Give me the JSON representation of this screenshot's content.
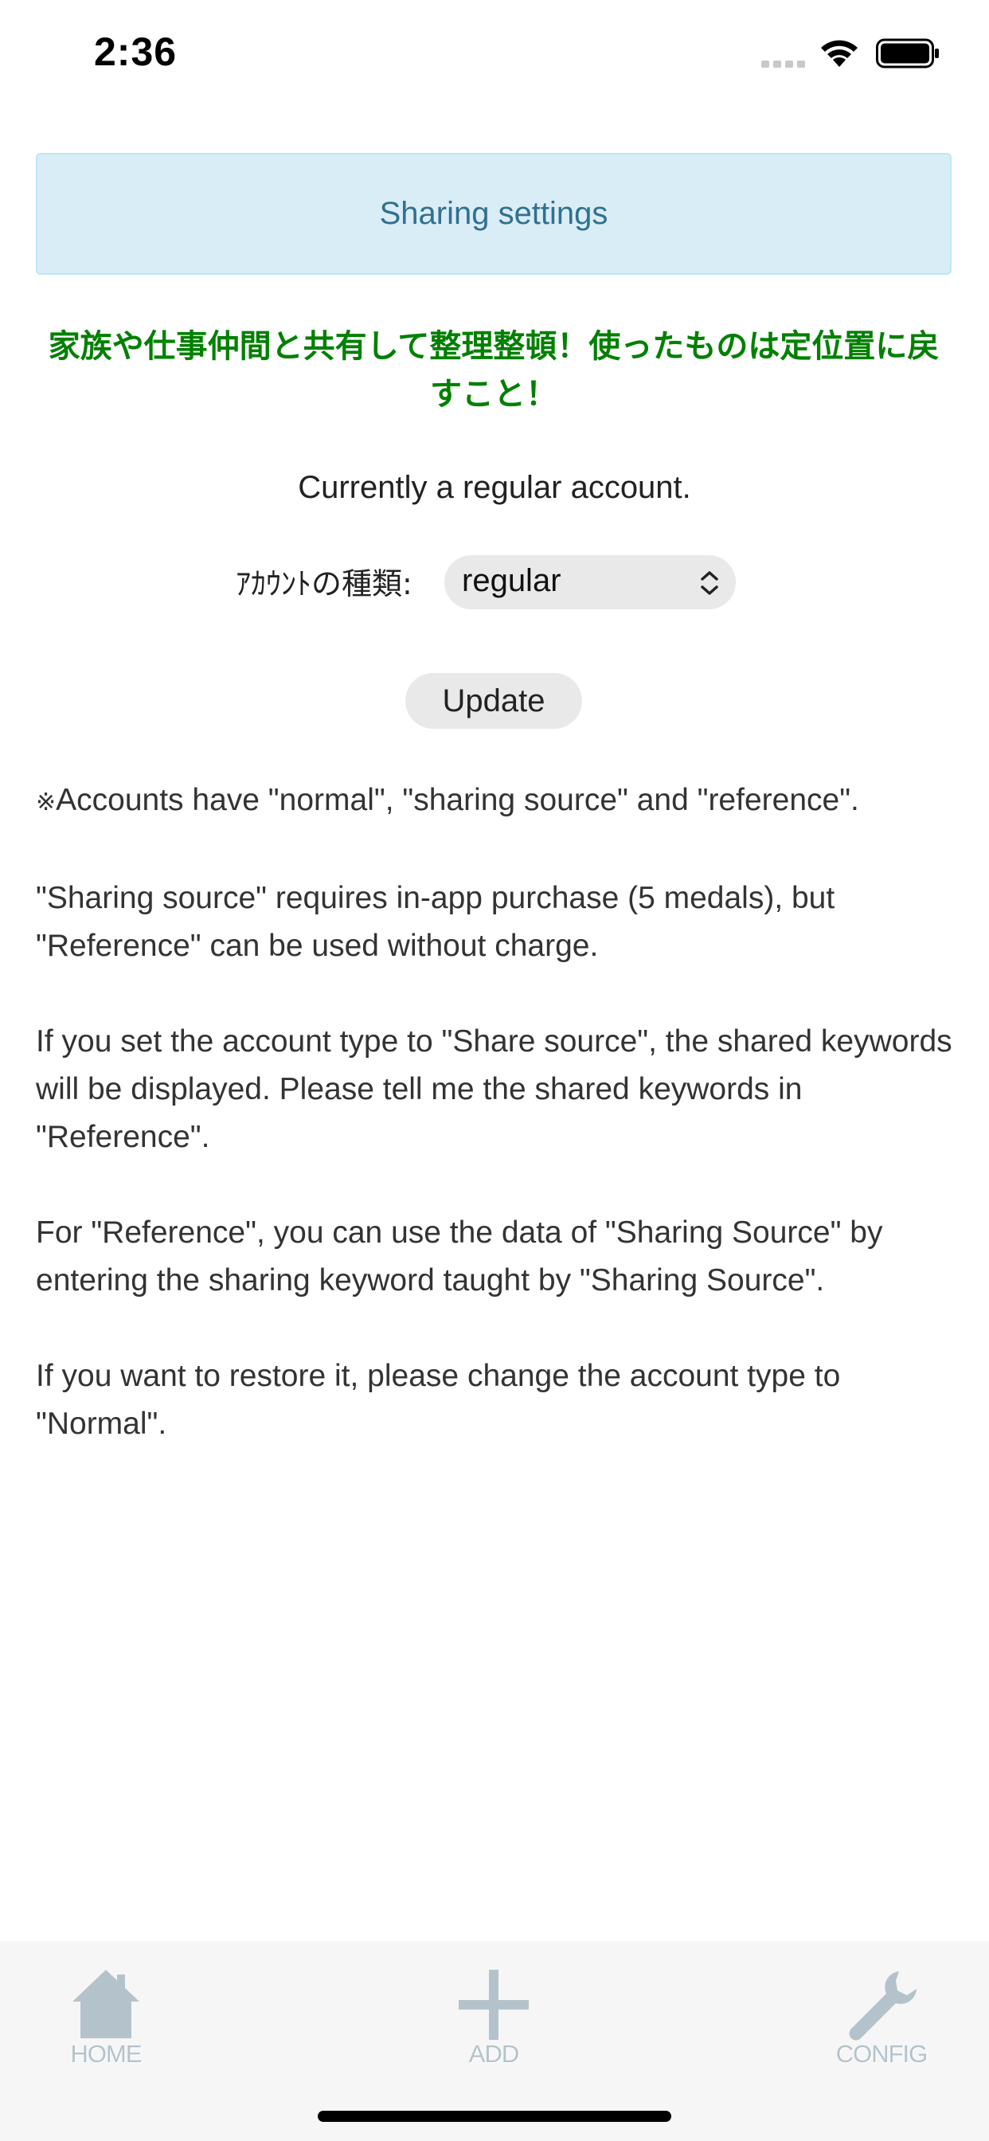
{
  "status_bar": {
    "time": "2:36"
  },
  "header": {
    "title": "Sharing settings"
  },
  "promo": {
    "text": "家族や仕事仲間と共有して整理整頓！使ったものは定位置に戻すこと！",
    "color": "#008000"
  },
  "account": {
    "status_text": "Currently a regular account.",
    "type_label": "ｱｶｳﾝﾄの種類:",
    "type_value": "regular",
    "update_label": "Update"
  },
  "description": {
    "note_mark": "※",
    "paragraph_1": "Accounts have \"normal\", \"sharing source\" and \"reference\".",
    "paragraph_2": "\"Sharing source\" requires in-app purchase (5 medals), but \"Reference\" can be used without charge.",
    "paragraph_3": "If you set the account type to \"Share source\", the shared keywords will be displayed. Please tell me the shared keywords in \"Reference\".",
    "paragraph_4": "For \"Reference\", you can use the data of \"Sharing Source\" by entering the sharing keyword taught by \"Sharing Source\".",
    "paragraph_5": "If you want to restore it, please change the account type to \"Normal\"."
  },
  "tab_bar": {
    "tabs": [
      {
        "label": "HOME",
        "icon": "home-icon"
      },
      {
        "label": "ADD",
        "icon": "plus-icon"
      },
      {
        "label": "CONFIG",
        "icon": "wrench-icon"
      }
    ]
  },
  "colors": {
    "banner_bg": "#d9edf7",
    "banner_text": "#31708f",
    "tab_icon": "#b4c3cb"
  }
}
